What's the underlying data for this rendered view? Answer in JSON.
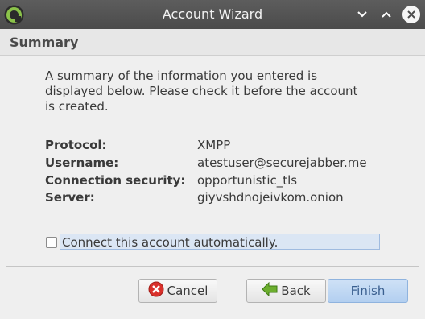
{
  "window": {
    "title": "Account Wizard"
  },
  "section": {
    "title": "Summary"
  },
  "summary": {
    "text": "A summary of the information you entered is\ndisplayed below. Please check it before the account\nis created."
  },
  "fields": [
    {
      "label": "Protocol:",
      "value": "XMPP"
    },
    {
      "label": "Username:",
      "value": "atestuser@securejabber.me"
    },
    {
      "label": "Connection security:",
      "value": "opportunistic_tls"
    },
    {
      "label": "Server:",
      "value": "giyvshdnojeivkom.onion"
    }
  ],
  "auto_connect": {
    "label": "Connect this account automatically.",
    "checked": false
  },
  "buttons": {
    "cancel": "Cancel",
    "back": "Back",
    "finish": "Finish"
  },
  "colors": {
    "titlebar": "#4b4b4b",
    "accent": "#b3cff0",
    "app_icon": "#8bc34a"
  },
  "icons": {
    "app": "pidgin-icon",
    "minimize": "chevron-down-icon",
    "maximize": "chevron-up-icon",
    "close": "close-icon",
    "cancel": "cancel-icon",
    "back": "back-arrow-icon"
  }
}
